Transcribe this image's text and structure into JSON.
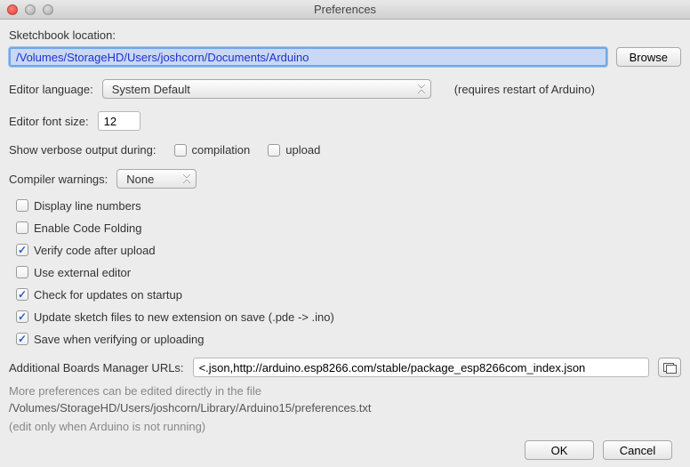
{
  "window": {
    "title": "Preferences"
  },
  "sketchbook": {
    "label": "Sketchbook location:",
    "value": "/Volumes/StorageHD/Users/joshcorn/Documents/Arduino",
    "browse": "Browse"
  },
  "language": {
    "label": "Editor language:",
    "value": "System Default",
    "hint": "(requires restart of Arduino)"
  },
  "fontsize": {
    "label": "Editor font size:",
    "value": "12"
  },
  "verbose": {
    "label": "Show verbose output during:",
    "compilation_label": "compilation",
    "compilation_checked": false,
    "upload_label": "upload",
    "upload_checked": false
  },
  "warnings": {
    "label": "Compiler warnings:",
    "value": "None"
  },
  "checks": {
    "display_line_numbers": {
      "label": "Display line numbers",
      "checked": false
    },
    "enable_code_folding": {
      "label": "Enable Code Folding",
      "checked": false
    },
    "verify_after_upload": {
      "label": "Verify code after upload",
      "checked": true
    },
    "external_editor": {
      "label": "Use external editor",
      "checked": false
    },
    "check_updates": {
      "label": "Check for updates on startup",
      "checked": true
    },
    "update_extension": {
      "label": "Update sketch files to new extension on save (.pde -> .ino)",
      "checked": true
    },
    "save_on_verify": {
      "label": "Save when verifying or uploading",
      "checked": true
    }
  },
  "boards": {
    "label": "Additional Boards Manager URLs:",
    "value": "<.json,http://arduino.esp8266.com/stable/package_esp8266com_index.json"
  },
  "footnotes": {
    "line1": "More preferences can be edited directly in the file",
    "path": "/Volumes/StorageHD/Users/joshcorn/Library/Arduino15/preferences.txt",
    "line2": "(edit only when Arduino is not running)"
  },
  "buttons": {
    "ok": "OK",
    "cancel": "Cancel"
  }
}
